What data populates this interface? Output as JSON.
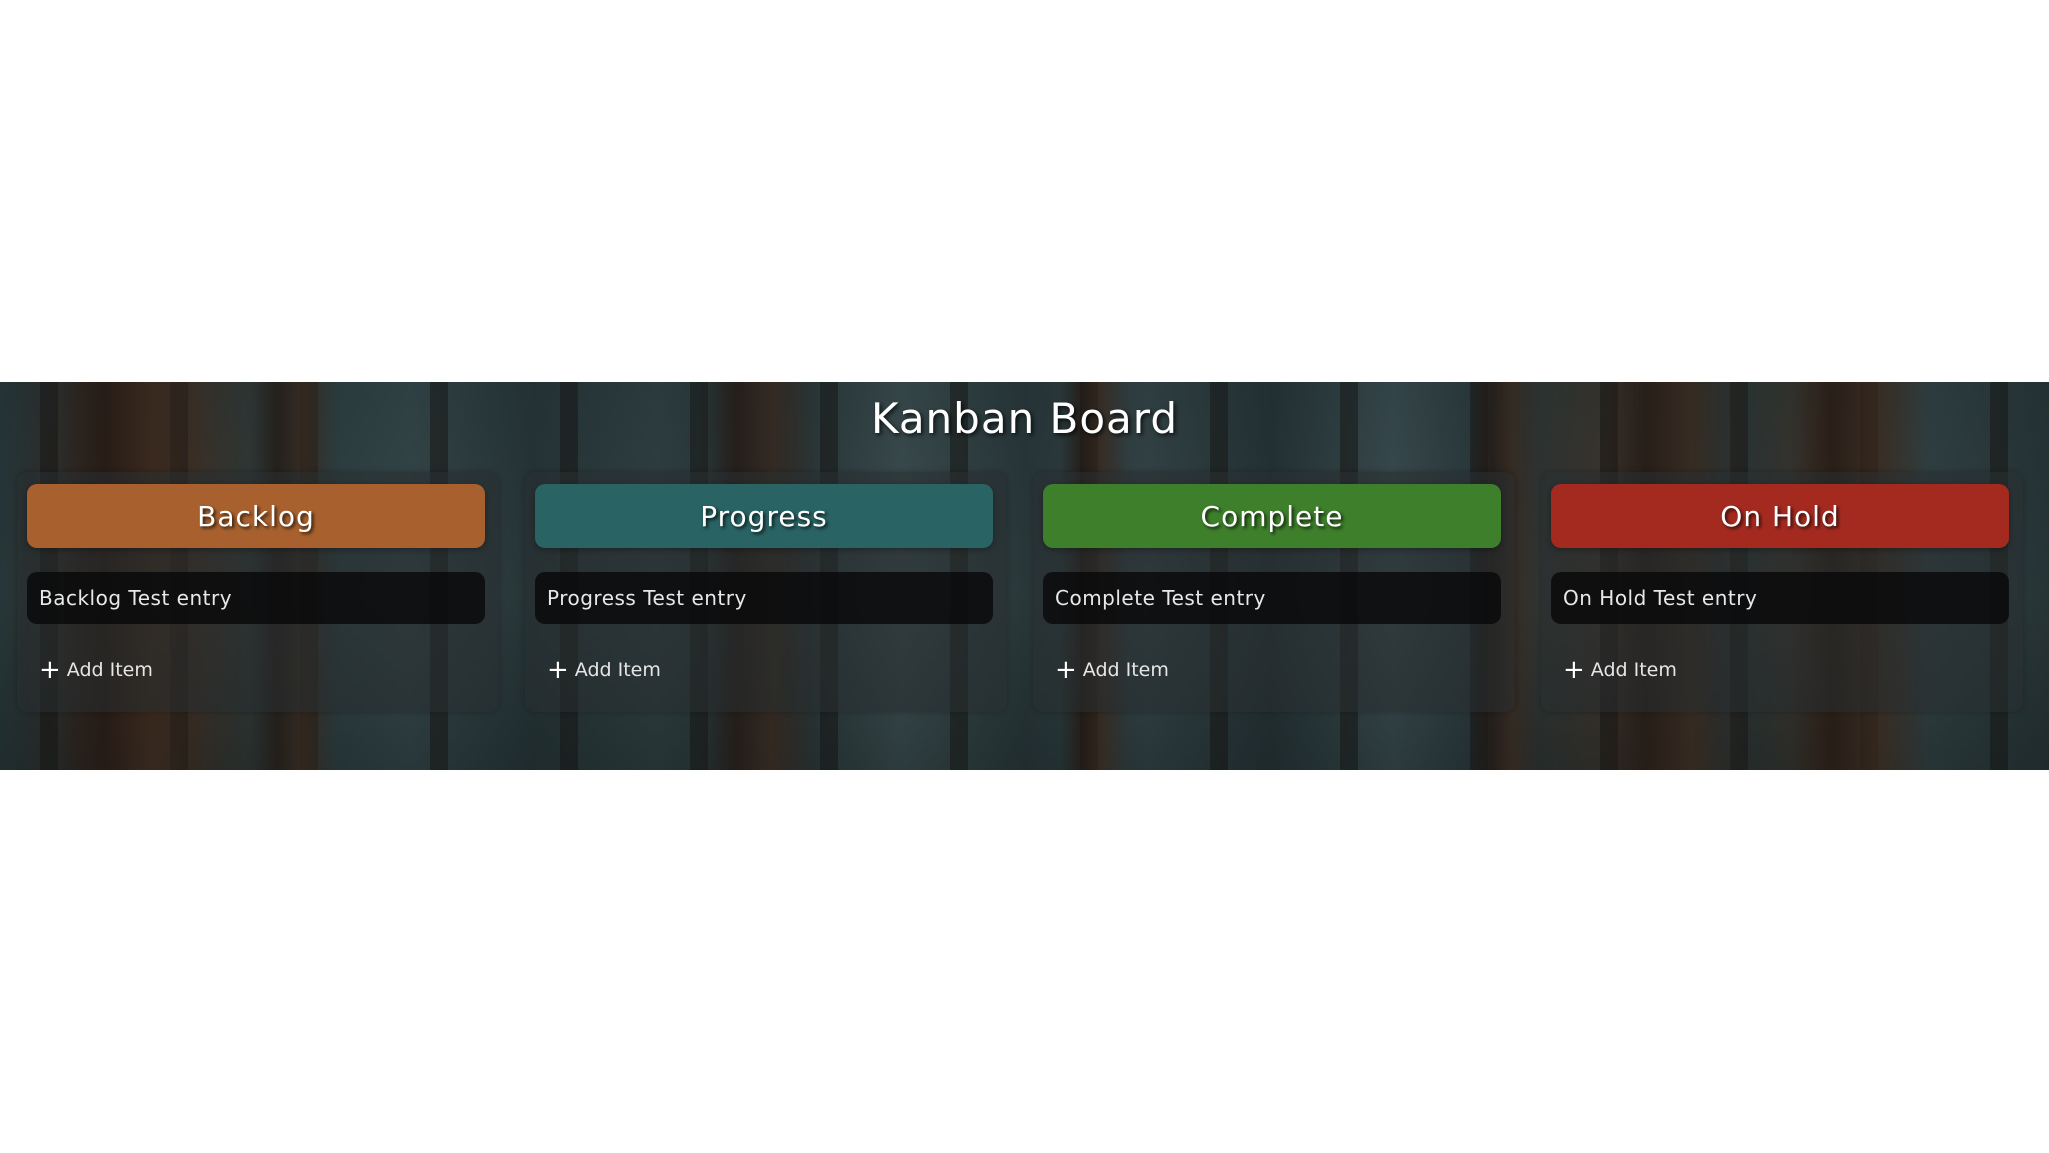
{
  "board": {
    "title": "Kanban Board"
  },
  "columns": [
    {
      "title": "Backlog",
      "color": "#a8612e",
      "entry": "Backlog Test entry",
      "add_label": "Add Item",
      "add_icon": "+"
    },
    {
      "title": "Progress",
      "color": "#2a6364",
      "entry": "Progress Test entry",
      "add_label": "Add Item",
      "add_icon": "+"
    },
    {
      "title": "Complete",
      "color": "#3d7f2a",
      "entry": "Complete Test entry",
      "add_label": "Add Item",
      "add_icon": "+"
    },
    {
      "title": "On Hold",
      "color": "#a42a20",
      "entry": "On Hold Test entry",
      "add_label": "Add Item",
      "add_icon": "+"
    }
  ]
}
